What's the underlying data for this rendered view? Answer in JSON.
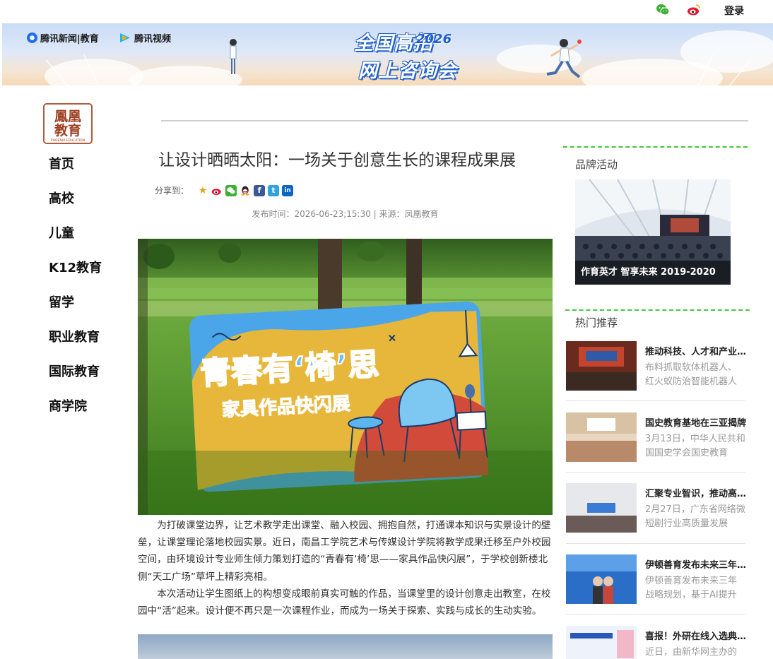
{
  "topbar": {
    "wechat_icon": "wechat-icon",
    "weibo_icon": "weibo-icon",
    "login_label": "登录"
  },
  "banner": {
    "brand_news": "腾讯新闻|教育",
    "brand_video": "腾讯视频",
    "title_line1": "全国高招",
    "title_year": "2026",
    "title_line2": "网上咨询会"
  },
  "logo": {
    "text_top": "鳳凰",
    "text_bottom": "教育",
    "text_small": "PHOENIX EDUCATION"
  },
  "nav": {
    "items": [
      "首页",
      "高校",
      "儿童",
      "K12教育",
      "留学",
      "职业教育",
      "国际教育",
      "商学院"
    ]
  },
  "article": {
    "title": "让设计晒晒太阳：一场关于创意生长的课程成果展",
    "share_label": "分享到：",
    "meta": "发布时间：2026-06-23;15:30 | 来源：凤凰教育",
    "hero_sign_line1": "青春有‘椅’思",
    "hero_sign_line2": "家具作品快闪展",
    "paragraphs": [
      "为打破课堂边界，让艺术教学走出课堂、融入校园、拥抱自然，打通课本知识与实景设计的壁垒，让课堂理论落地校园实景。近日，南昌工学院艺术与传媒设计学院将教学成果迁移至户外校园空间，由环境设计专业师生倾力策划打造的“青春有‘椅’思——家具作品快闪展”，于学校创新楼北侧“天工广场”草坪上精彩亮相。",
      "本次活动让学生图纸上的构想变成眼前真实可触的作品，当课堂里的设计创意走出教室，在校园中“活”起来。设计便不再只是一次课程作业，而成为一场关于探索、实践与成长的生动实验。"
    ]
  },
  "sidebar": {
    "brand_heading": "品牌活动",
    "brand_caption": "作育英才 智享未来 2019-2020",
    "hot_heading": "热门推荐",
    "hot_items": [
      {
        "title": "推动科技、人才和产业融合",
        "desc": "布料抓取软体机器人、红火蚁防治智能机器人"
      },
      {
        "title": "国史教育基地在三亚揭牌",
        "desc": "3月13日，中华人民共和国国史学会国史教育"
      },
      {
        "title": "汇聚专业智识，推动高质量发展",
        "desc": "2月27日，广东省网络微短剧行业高质量发展"
      },
      {
        "title": "伊顿善育发布未来三年战略",
        "desc": "伊顿善育发布未来三年战略规划，基于AI提升"
      },
      {
        "title": "喜报！外研在线入选典型案例",
        "desc": "近日，由新华网主办的"
      }
    ]
  }
}
